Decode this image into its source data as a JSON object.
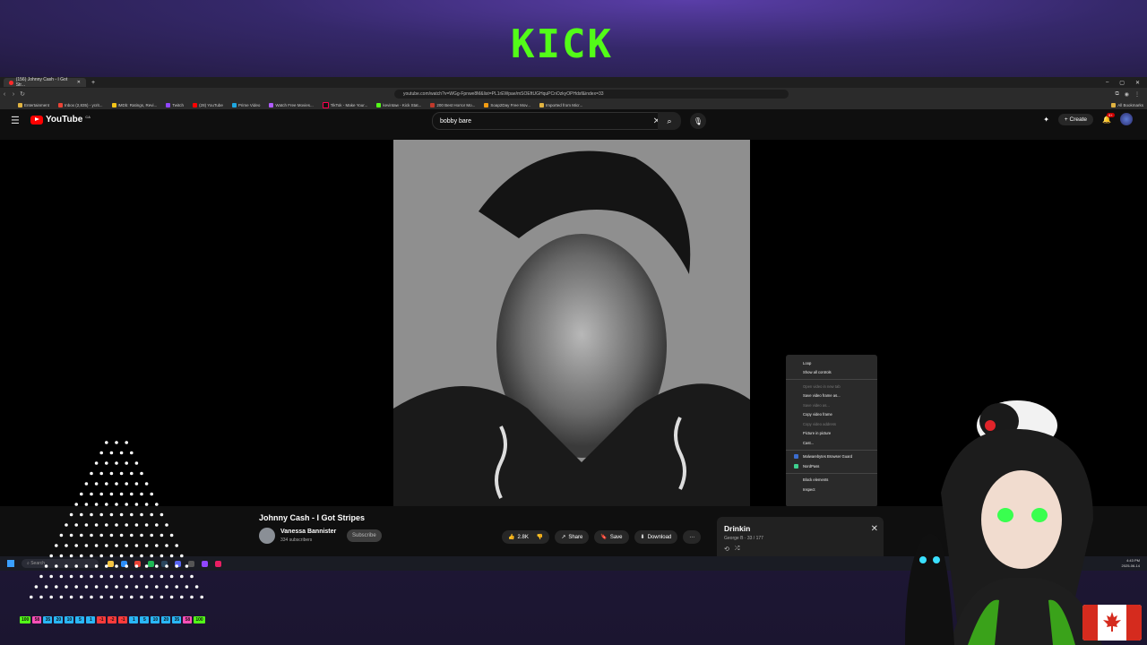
{
  "stream": {
    "logo_text": "KICK"
  },
  "browser": {
    "tab_title": "(156) Johnny Cash - I Got Str...",
    "new_tab": "+",
    "url": "youtube.com/watch?v=WGg-Fpnwe8M&list=PL1rEWpae/mSOEftUGHquPCnOzkyOPHdsf&index=33",
    "bookmarks": [
      "Entertainment",
      "Inbox (2,835) - ycrit...",
      "IMDb: Ratings, Revi...",
      "Twitch",
      "(28) YouTube",
      "Prime Video",
      "Watch Free Movies...",
      "TikTok - Make Your...",
      "kevintaw - Kick Stat...",
      "200 Best Horror Mo...",
      "Soap2Day Free Mov...",
      "Imported from Micr..."
    ],
    "all_bookmarks": "All Bookmarks"
  },
  "youtube": {
    "logo": "YouTube",
    "region": "CA",
    "search_value": "bobby bare",
    "create_label": "Create",
    "notif_count": "9+"
  },
  "context_menu": {
    "items": [
      {
        "label": "Loop",
        "disabled": false
      },
      {
        "label": "Show all controls",
        "disabled": false
      },
      {
        "sep": true
      },
      {
        "label": "Open video in new tab",
        "disabled": true
      },
      {
        "label": "Save video frame as...",
        "disabled": false
      },
      {
        "label": "Save video as...",
        "disabled": true
      },
      {
        "label": "Copy video frame",
        "disabled": false
      },
      {
        "label": "Copy video address",
        "disabled": true
      },
      {
        "label": "Picture in picture",
        "disabled": false
      },
      {
        "label": "Cast...",
        "disabled": false
      },
      {
        "sep": true
      },
      {
        "label": "Malwarebytes Browser Guard",
        "disabled": false,
        "icon": "#3b6ccf"
      },
      {
        "label": "NordPass",
        "disabled": false,
        "icon": "#3ecf8e"
      },
      {
        "sep": true
      },
      {
        "label": "Block elements",
        "disabled": false
      },
      {
        "label": "Inspect",
        "disabled": false
      }
    ]
  },
  "video": {
    "title": "Johnny Cash - I Got Stripes",
    "channel": "Vanessa Bannister",
    "subscribers": "334 subscribers",
    "subscribe_label": "Subscribe",
    "likes": "2.8K",
    "share_label": "Share",
    "save_label": "Save",
    "download_label": "Download",
    "more_label": "···"
  },
  "playlist": {
    "title": "Drinkin",
    "subtitle": "George B · 33 / 177"
  },
  "taskbar": {
    "search_placeholder": "Search",
    "time": "4:43 PM",
    "date": "2025-06-14"
  },
  "counter": {
    "values": [
      "100",
      "58",
      "35",
      "20",
      "10",
      "5",
      "1",
      "-1",
      "-2",
      "-1",
      "1",
      "5",
      "10",
      "20",
      "35",
      "58",
      "100"
    ],
    "colors": [
      "#53fc18",
      "#ff4fb8",
      "#29b6f6",
      "#29b6f6",
      "#29b6f6",
      "#29b6f6",
      "#29b6f6",
      "#ff3b3b",
      "#ff3b3b",
      "#ff3b3b",
      "#29b6f6",
      "#29b6f6",
      "#29b6f6",
      "#29b6f6",
      "#29b6f6",
      "#ff4fb8",
      "#53fc18"
    ]
  }
}
